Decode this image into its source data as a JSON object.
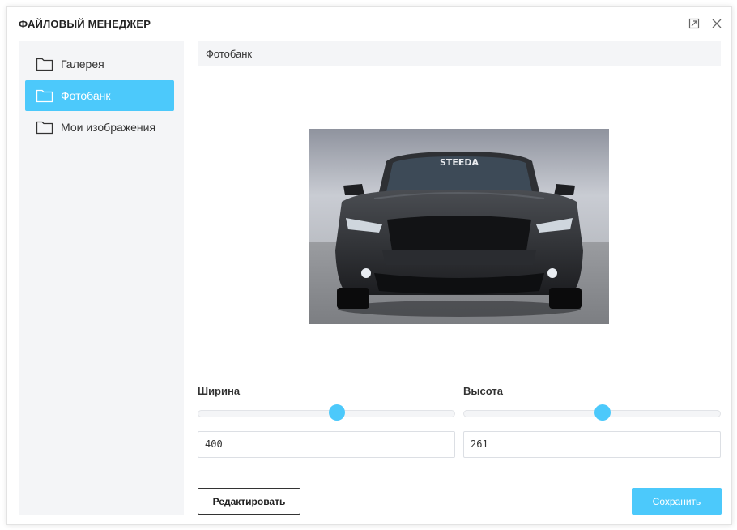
{
  "dialog": {
    "title": "ФАЙЛОВЫЙ МЕНЕДЖЕР",
    "maximize_icon": "expand-icon",
    "close_icon": "close-icon"
  },
  "sidebar": {
    "items": [
      {
        "label": "Галерея",
        "icon": "folder-icon",
        "active": false
      },
      {
        "label": "Фотобанк",
        "icon": "folder-icon",
        "active": true
      },
      {
        "label": "Мои изображения",
        "icon": "folder-icon",
        "active": false
      }
    ]
  },
  "main": {
    "breadcrumb": "Фотобанк",
    "preview_text": "STEEDA",
    "width_label": "Ширина",
    "height_label": "Высота",
    "width_value": "400",
    "height_value": "261",
    "width_slider_level": 0.54,
    "height_slider_level": 0.54
  },
  "buttons": {
    "edit": "Редактировать",
    "save": "Сохранить"
  },
  "colors": {
    "accent": "#4cc9fb",
    "panel": "#f4f5f7"
  }
}
